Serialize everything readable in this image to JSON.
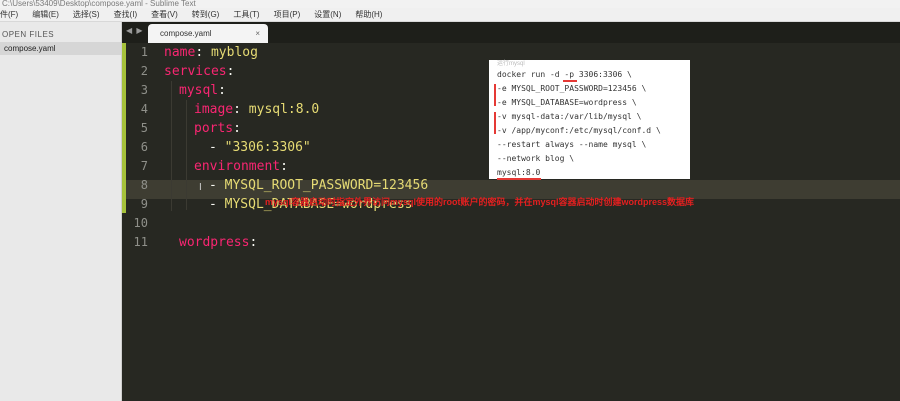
{
  "window": {
    "title": "C:\\Users\\53409\\Desktop\\compose.yaml - Sublime Text"
  },
  "menu": [
    "件(F)",
    "编辑(E)",
    "选择(S)",
    "查找(I)",
    "查看(V)",
    "转到(G)",
    "工具(T)",
    "项目(P)",
    "设置(N)",
    "帮助(H)"
  ],
  "sidebar": {
    "header": "OPEN FILES",
    "files": [
      "compose.yaml"
    ]
  },
  "tabs": {
    "nav": "◀ ▶",
    "active": "compose.yaml"
  },
  "editor": {
    "lines": [
      {
        "n": "1",
        "key": "name",
        "colon": ": ",
        "val": "myblog"
      },
      {
        "n": "2",
        "key": "services",
        "colon": ":",
        "val": ""
      },
      {
        "n": "3",
        "key": "mysql",
        "colon": ":",
        "val": ""
      },
      {
        "n": "4",
        "key": "image",
        "colon": ": ",
        "val": "mysql:8.0"
      },
      {
        "n": "5",
        "key": "ports",
        "colon": ":",
        "val": ""
      },
      {
        "n": "6",
        "key": "",
        "colon": "",
        "val": "- \"3306:3306\""
      },
      {
        "n": "7",
        "key": "environment",
        "colon": ":",
        "val": ""
      },
      {
        "n": "8",
        "key": "",
        "colon": "",
        "val": "- MYSQL_ROOT_PASSWORD=123456"
      },
      {
        "n": "9",
        "key": "",
        "colon": "",
        "val": "- MYSQL_DATABASE=wordpress"
      },
      {
        "n": "10",
        "key": "",
        "colon": "",
        "val": ""
      },
      {
        "n": "11",
        "key": "wordpress",
        "colon": ":",
        "val": ""
      }
    ]
  },
  "docker_image": {
    "caption": "运行mysql",
    "lines": [
      "docker run -d -p 3306:3306 \\",
      "-e MYSQL_ROOT_PASSWORD=123456 \\",
      "-e MYSQL_DATABASE=wordpress \\",
      "-v mysql-data:/var/lib/mysql \\",
      "-v /app/myconf:/etc/mysql/conf.d \\",
      "--restart always --name mysql \\",
      "--network blog \\",
      "mysql:8.0"
    ]
  },
  "annotation": "mysql容器启动时指定外界访问mysql使用的root账户的密码，并在mysql容器启动时创建wordpress数据库",
  "colors": {
    "key": "#f92672",
    "string": "#e6db74",
    "annotation": "#e32020",
    "gutter_accent": "#a6c23b"
  }
}
